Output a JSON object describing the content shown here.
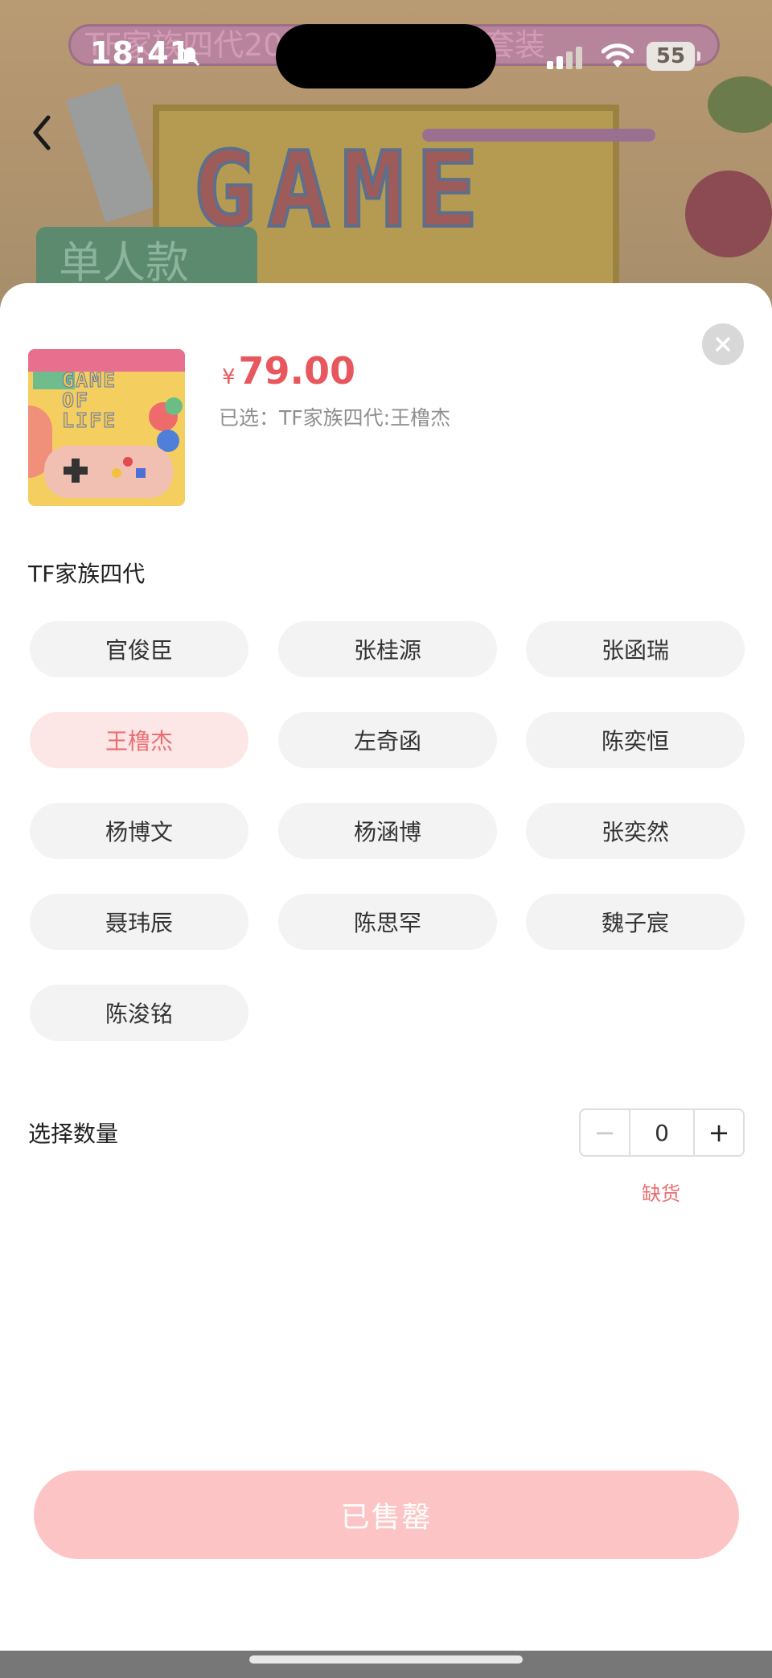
{
  "status_bar": {
    "time": "18:41",
    "battery": "55"
  },
  "background": {
    "banner_text": "TF家族四代2026 单人款台历套装",
    "hero_title": "GAME",
    "hero_tag": "单人款"
  },
  "product": {
    "currency": "¥",
    "price": "79.00",
    "selected_text": "已选：TF家族四代:王橹杰",
    "thumb_title": "GAME\nOF\nLIFE"
  },
  "group": {
    "title": "TF家族四代",
    "options": [
      {
        "label": "官俊臣",
        "selected": false
      },
      {
        "label": "张桂源",
        "selected": false
      },
      {
        "label": "张函瑞",
        "selected": false
      },
      {
        "label": "王橹杰",
        "selected": true
      },
      {
        "label": "左奇函",
        "selected": false
      },
      {
        "label": "陈奕恒",
        "selected": false
      },
      {
        "label": "杨博文",
        "selected": false
      },
      {
        "label": "杨涵博",
        "selected": false
      },
      {
        "label": "张奕然",
        "selected": false
      },
      {
        "label": "聂玮辰",
        "selected": false
      },
      {
        "label": "陈思罕",
        "selected": false
      },
      {
        "label": "魏子宸",
        "selected": false
      },
      {
        "label": "陈浚铭",
        "selected": false
      }
    ]
  },
  "quantity": {
    "label": "选择数量",
    "minus": "−",
    "value": "0",
    "plus": "+",
    "stock_status": "缺货"
  },
  "action": {
    "button_label": "已售罄"
  },
  "colors": {
    "accent": "#e8575d",
    "selected_bg": "#fde6e6",
    "button_bg": "#fcc4c4"
  }
}
